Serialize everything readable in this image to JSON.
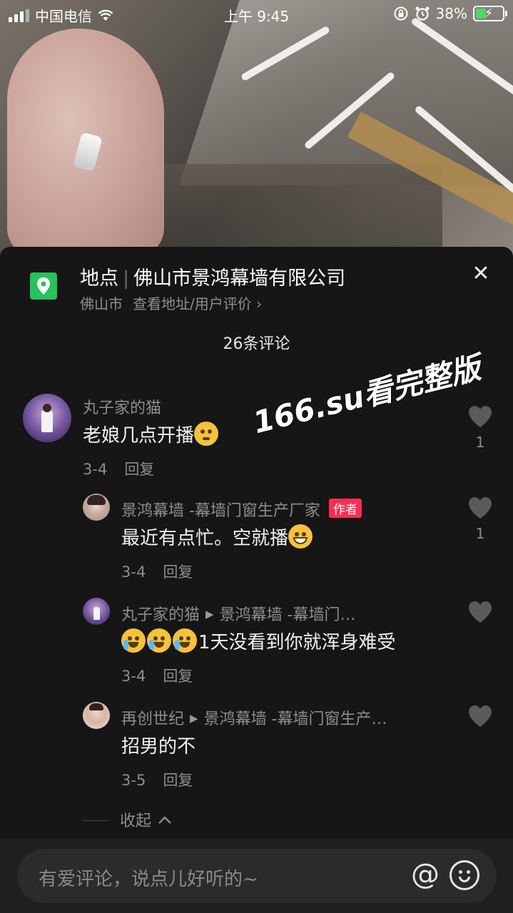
{
  "status_bar": {
    "carrier": "中国电信",
    "time": "上午 9:45",
    "battery_percent": "38%",
    "battery_level": 0.38
  },
  "location": {
    "label": "地点",
    "name": "佛山市景鸿幕墙有限公司",
    "city": "佛山市",
    "link": "查看地址/用户评价",
    "link_chevron": "›"
  },
  "comment_count": "26条评论",
  "watermark": "166.su看完整版",
  "comments": [
    {
      "user": "丸子家的猫",
      "text": "老娘几点开播",
      "date": "3-4",
      "reply": "回复",
      "likes": "1"
    },
    {
      "user": "景鸿幕墙 -幕墙门窗生产厂家",
      "badge": "作者",
      "text": "最近有点忙。空就播",
      "date": "3-4",
      "reply": "回复",
      "likes": "1"
    },
    {
      "user": "丸子家的猫",
      "reply_to": "景鸿幕墙 -幕墙门…",
      "text": "1天没看到你就浑身难受",
      "date": "3-4",
      "reply": "回复"
    },
    {
      "user": "再创世纪",
      "reply_to": "景鸿幕墙 -幕墙门窗生产…",
      "text": "招男的不",
      "date": "3-5",
      "reply": "回复"
    }
  ],
  "collapse_label": "收起",
  "input": {
    "placeholder": "有爱评论，说点儿好听的~",
    "at_symbol": "@"
  },
  "colors": {
    "background": "#161616",
    "location_pin": "#26c25d",
    "author_badge": "#fe2c55",
    "secondary_text": "#8d8d8d"
  }
}
